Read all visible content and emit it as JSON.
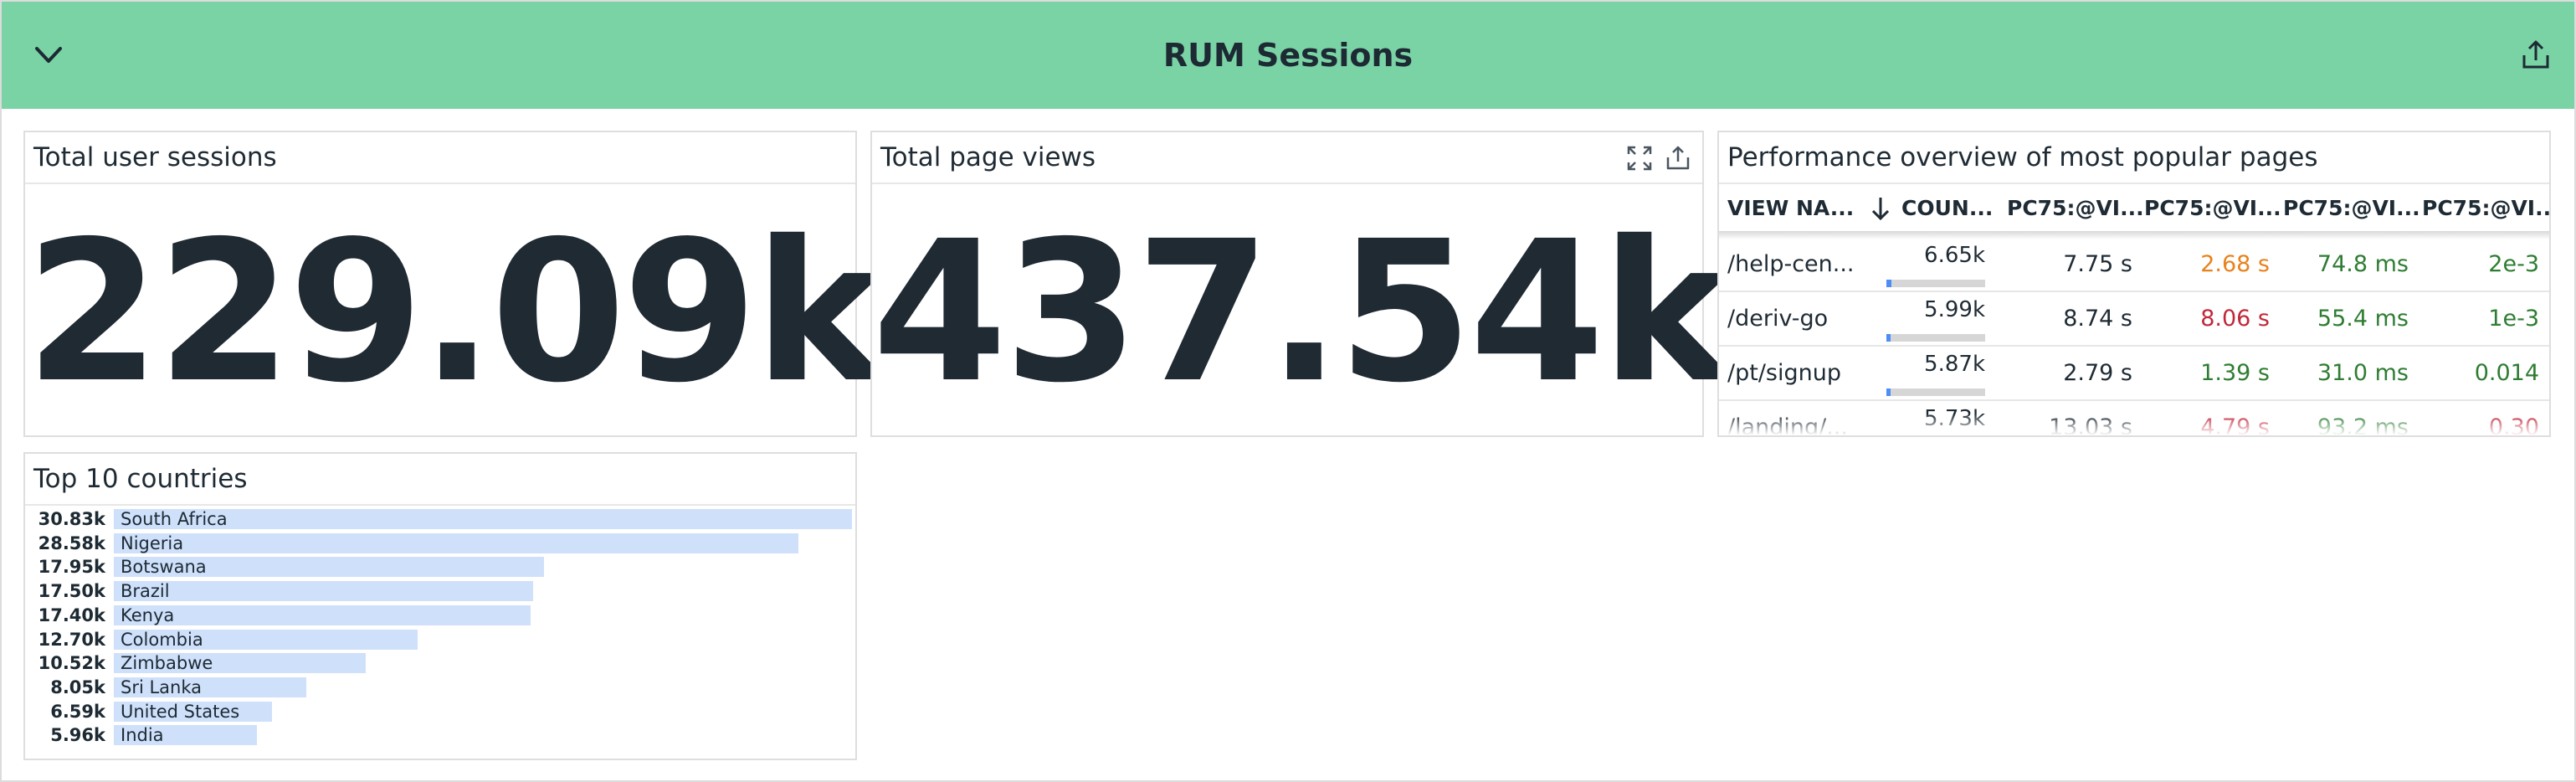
{
  "header": {
    "title": "RUM Sessions"
  },
  "sessions": {
    "title": "Total user sessions",
    "value": "229.09k"
  },
  "pageviews": {
    "title": "Total page views",
    "value": "437.54k"
  },
  "perf": {
    "title": "Performance overview of most popular pages",
    "columns": [
      "VIEW NA...",
      "COUN...",
      "PC75:@VI...",
      "PC75:@VI...",
      "PC75:@VI...",
      "PC75:@VI..."
    ],
    "rows": [
      {
        "view": "/help-cen...",
        "count": "6.65k",
        "count_fraction": 0.05,
        "c1": "7.75 s",
        "c2": "2.68 s",
        "c2_color": "#e8821c",
        "c3": "74.8 ms",
        "c3_color": "#2e7d32",
        "c4": "2e-3",
        "c4_color": "#2e7d32"
      },
      {
        "view": "/deriv-go",
        "count": "5.99k",
        "count_fraction": 0.04,
        "c1": "8.74 s",
        "c2": "8.06 s",
        "c2_color": "#c0283a",
        "c3": "55.4 ms",
        "c3_color": "#2e7d32",
        "c4": "1e-3",
        "c4_color": "#2e7d32"
      },
      {
        "view": "/pt/signup",
        "count": "5.87k",
        "count_fraction": 0.04,
        "c1": "2.79 s",
        "c2": "1.39 s",
        "c2_color": "#2e7d32",
        "c3": "31.0 ms",
        "c3_color": "#2e7d32",
        "c4": "0.014",
        "c4_color": "#2e7d32"
      },
      {
        "view": "/landing/...",
        "count": "5.73k",
        "count_fraction": 0.04,
        "c1": "13.03 s",
        "c2": "4.79 s",
        "c2_color": "#c0283a",
        "c3": "93.2 ms",
        "c3_color": "#2e7d32",
        "c4": "0.30",
        "c4_color": "#c0283a"
      }
    ]
  },
  "countries": {
    "title": "Top 10 countries",
    "max": 30.83,
    "items": [
      {
        "value": "30.83k",
        "num": 30.83,
        "name": "South Africa"
      },
      {
        "value": "28.58k",
        "num": 28.58,
        "name": "Nigeria"
      },
      {
        "value": "17.95k",
        "num": 17.95,
        "name": "Botswana"
      },
      {
        "value": "17.50k",
        "num": 17.5,
        "name": "Brazil"
      },
      {
        "value": "17.40k",
        "num": 17.4,
        "name": "Kenya"
      },
      {
        "value": "12.70k",
        "num": 12.7,
        "name": "Colombia"
      },
      {
        "value": "10.52k",
        "num": 10.52,
        "name": "Zimbabwe"
      },
      {
        "value": "8.05k",
        "num": 8.05,
        "name": "Sri Lanka"
      },
      {
        "value": "6.59k",
        "num": 6.59,
        "name": "United States"
      },
      {
        "value": "5.96k",
        "num": 5.96,
        "name": "India"
      }
    ]
  }
}
